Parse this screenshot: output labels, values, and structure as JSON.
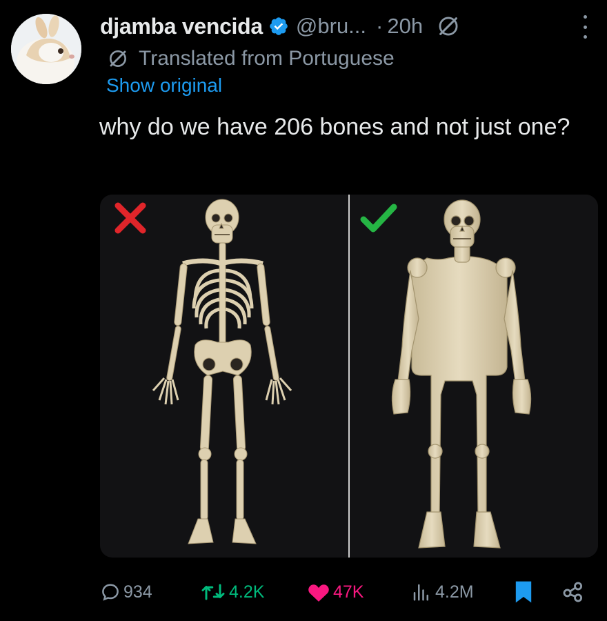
{
  "tweet": {
    "display_name": "djamba vencida",
    "handle": "@bru...",
    "separator": "·",
    "time": "20h",
    "translated_label": "Translated from Portuguese",
    "show_original": "Show original",
    "text": "why do we have 206 bones and not just one?",
    "icons": [
      "verified-badge-icon",
      "grok-icon",
      "more-icon",
      "translate-icon"
    ]
  },
  "media": {
    "left_mark": "x-mark",
    "right_mark": "check-mark"
  },
  "actions": {
    "replies": "934",
    "reposts": "4.2K",
    "likes": "47K",
    "views": "4.2M",
    "bookmarked": true
  },
  "colors": {
    "background": "#000000",
    "text": "#e7e9ea",
    "muted": "#8b98a5",
    "link": "#1d9bf0",
    "repost": "#00ba7c",
    "like": "#f91880",
    "bookmark": "#1d9bf0",
    "x_mark": "#e0252a",
    "check_mark": "#25b544",
    "bone": "#ddd0b0"
  }
}
